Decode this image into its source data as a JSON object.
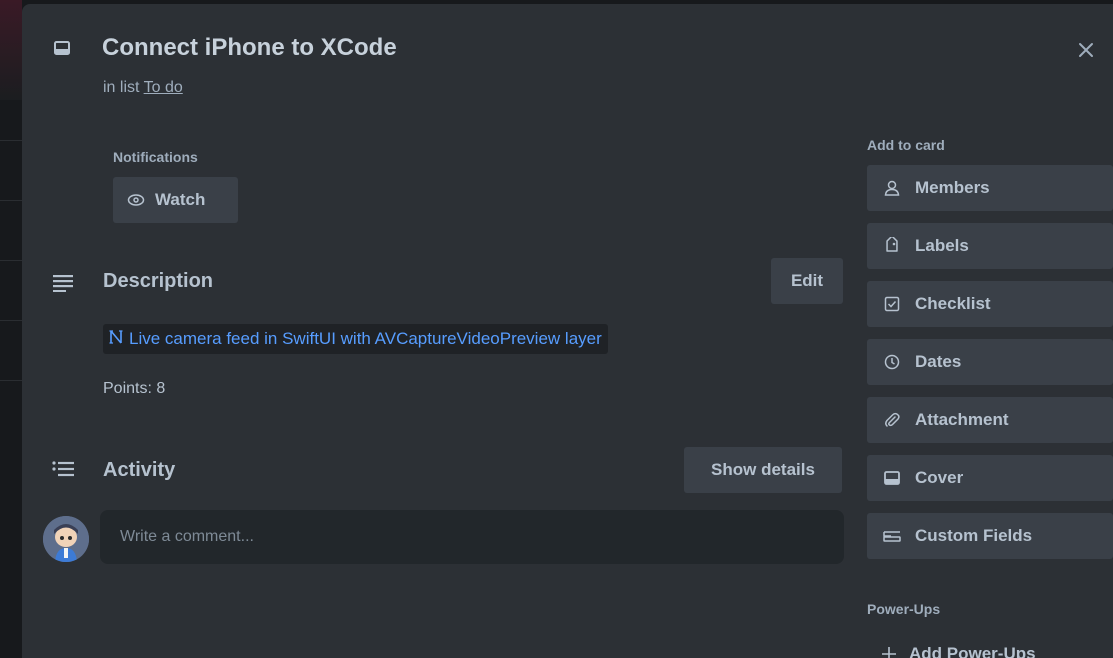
{
  "card": {
    "title": "Connect iPhone to XCode",
    "list_prefix": "in list",
    "list_name": "To do"
  },
  "notifications": {
    "heading": "Notifications",
    "watch_label": "Watch"
  },
  "description": {
    "heading": "Description",
    "edit_label": "Edit",
    "link_text": "Live camera feed in SwiftUI with AVCaptureVideoPreview layer",
    "points_text": "Points: 8"
  },
  "activity": {
    "heading": "Activity",
    "show_details_label": "Show details",
    "comment_placeholder": "Write a comment..."
  },
  "sidebar": {
    "add_to_card_heading": "Add to card",
    "items": [
      {
        "label": "Members",
        "icon": "person-icon"
      },
      {
        "label": "Labels",
        "icon": "tag-icon"
      },
      {
        "label": "Checklist",
        "icon": "checklist-icon"
      },
      {
        "label": "Dates",
        "icon": "clock-icon"
      },
      {
        "label": "Attachment",
        "icon": "paperclip-icon"
      },
      {
        "label": "Cover",
        "icon": "cover-icon"
      },
      {
        "label": "Custom Fields",
        "icon": "custom-fields-icon"
      }
    ],
    "powerups_heading": "Power-Ups",
    "add_powerups_label": "Add Power-Ups"
  },
  "colors": {
    "modal_bg": "#2c3035",
    "button_bg": "#3a4048",
    "text": "#b6c2cf",
    "link": "#579dff"
  }
}
